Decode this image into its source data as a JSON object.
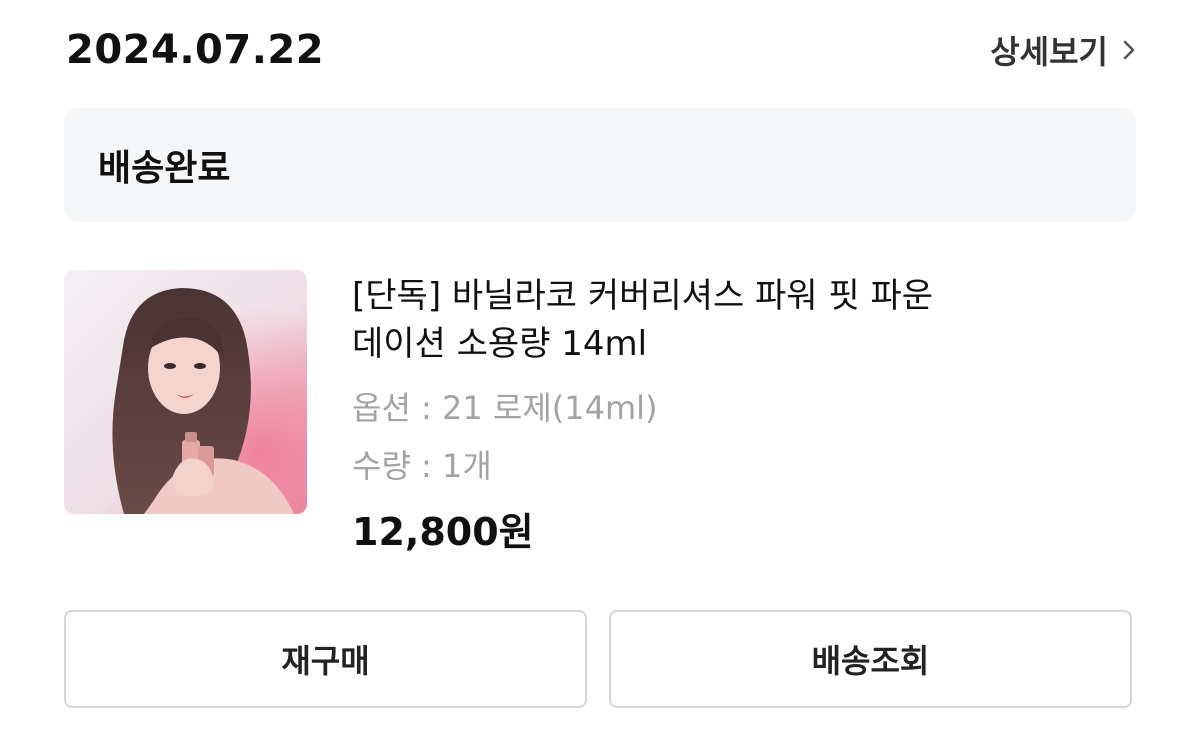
{
  "order": {
    "date": "2024.07.22",
    "detail_label": "상세보기",
    "detail_icon": "chevron-right-icon"
  },
  "status": {
    "label": "배송완료"
  },
  "product": {
    "name_line1": "[단독] 바닐라코 커버리셔스 파워 핏 파운",
    "name_line2": "데이션 소용량 14ml",
    "option": "옵션 : 21 로제(14ml)",
    "quantity": "수량 : 1개",
    "price": "12,800원"
  },
  "actions": {
    "reorder_label": "재구매",
    "tracking_label": "배송조회"
  },
  "colors": {
    "status_bg": "#f4f6f8",
    "muted_text": "#a3a3a3",
    "button_border": "#d6d6d6"
  }
}
